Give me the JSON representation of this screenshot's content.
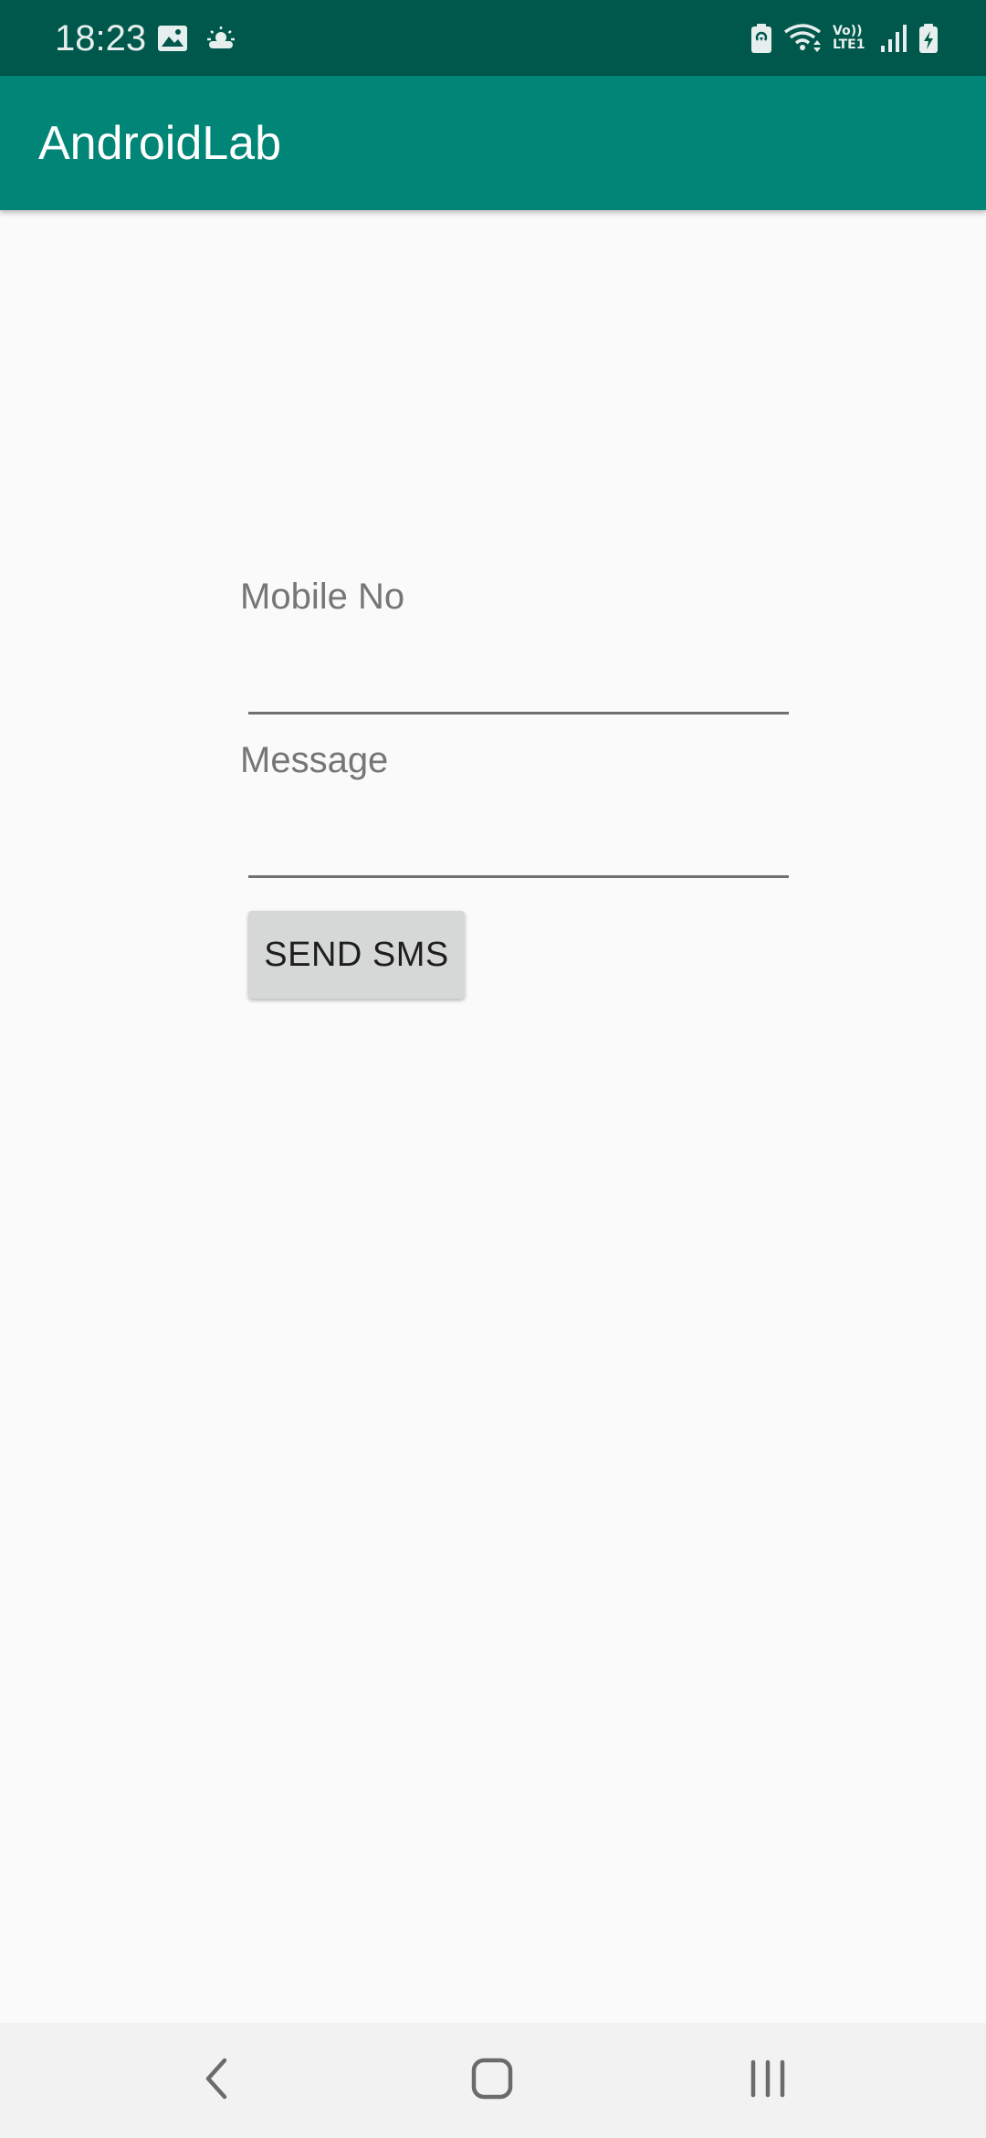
{
  "status_bar": {
    "time": "18:23",
    "network_label": "Vo)) LTE1",
    "icons": [
      "gallery-icon",
      "weather-icon",
      "battery-saver-icon",
      "wifi-icon",
      "volte-lte-icon",
      "signal-icon",
      "battery-charging-icon"
    ]
  },
  "app_bar": {
    "title": "AndroidLab"
  },
  "form": {
    "mobile_label": "Mobile No",
    "mobile_value": "",
    "message_label": "Message",
    "message_value": "",
    "send_button": "SEND SMS"
  },
  "nav_bar": {
    "buttons": [
      "back",
      "home",
      "recents"
    ]
  },
  "colors": {
    "status_bar": "#00574b",
    "app_bar": "#008577",
    "background": "#fafafa",
    "button": "#d6d7d7",
    "nav_bar": "#f2f2f2"
  }
}
